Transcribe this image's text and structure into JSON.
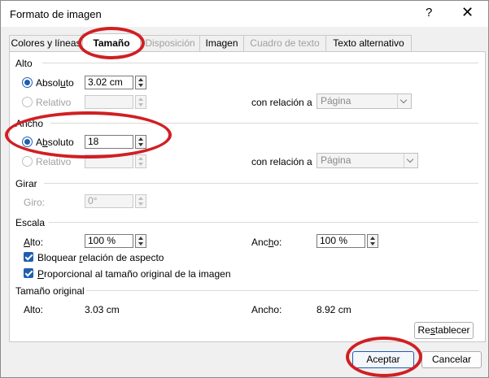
{
  "window": {
    "title": "Formato de imagen",
    "help": "?",
    "close": "✕"
  },
  "tabs": [
    "Colores y líneas",
    "Tamaño",
    "Disposición",
    "Imagen",
    "Cuadro de texto",
    "Texto alternativo"
  ],
  "alto": {
    "section": "Alto",
    "abs_pre": "Absol",
    "abs_u": "u",
    "abs_post": "to",
    "abs_value": "3.02 cm",
    "rel_label": "Relativo",
    "relation_label": "con relación a",
    "relation_value": "Página"
  },
  "ancho": {
    "section": "Ancho",
    "abs_pre": "A",
    "abs_u": "b",
    "abs_post": "soluto",
    "abs_value": "18",
    "rel_label": "Relativo",
    "relation_label": "con relación a",
    "relation_value": "Página"
  },
  "girar": {
    "section": "Girar",
    "label": "Giro:",
    "value": "0°"
  },
  "escala": {
    "section": "Escala",
    "alto_u": "A",
    "alto_rest": "lto:",
    "alto_value": "100 %",
    "ancho_pre": "Anc",
    "ancho_u": "h",
    "ancho_post": "o:",
    "ancho_value": "100 %",
    "lock_pre": "Bloquear ",
    "lock_u": "r",
    "lock_post": "elación de aspecto",
    "prop_u": "P",
    "prop_rest": "roporcional al tamaño original de la imagen"
  },
  "original": {
    "section": "Tamaño original",
    "alto_label": "Alto:",
    "alto_value": "3.03 cm",
    "ancho_label": "Ancho:",
    "ancho_value": "8.92 cm"
  },
  "buttons": {
    "reset_pre": "Re",
    "reset_u": "s",
    "reset_post": "tablecer",
    "ok": "Aceptar",
    "cancel": "Cancelar"
  },
  "colors": {
    "accent": "#1e5fb0",
    "annotation": "#d01f24"
  }
}
